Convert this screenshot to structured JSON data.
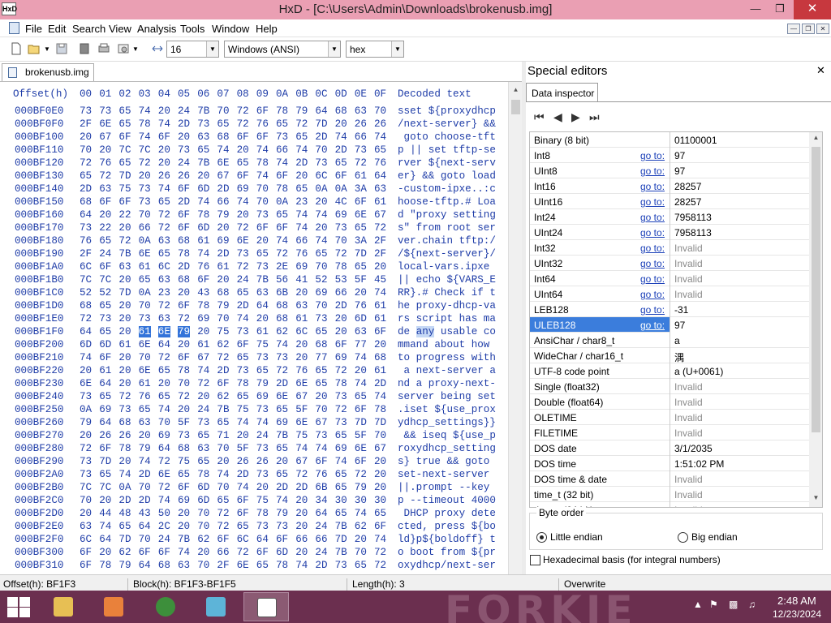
{
  "window": {
    "title": "HxD - [C:\\Users\\Admin\\Downloads\\brokenusb.img]",
    "app_icon": "HxD"
  },
  "menu": [
    "File",
    "Edit",
    "Search",
    "View",
    "Analysis",
    "Tools",
    "Window",
    "Help"
  ],
  "toolbar": {
    "bytes_per_row": "16",
    "charset": "Windows (ANSI)",
    "offset_base": "hex"
  },
  "tab": {
    "label": "brokenusb.img"
  },
  "hex": {
    "header": {
      "offset": "Offset(h)",
      "columns": [
        "00",
        "01",
        "02",
        "03",
        "04",
        "05",
        "06",
        "07",
        "08",
        "09",
        "0A",
        "0B",
        "0C",
        "0D",
        "0E",
        "0F"
      ],
      "decoded": "Decoded text"
    },
    "rows": [
      {
        "offset": "000BF0E0",
        "bytes": "73 73 65 74 20 24 7B 70 72 6F 78 79 64 68 63 70",
        "text": "sset ${proxydhcp"
      },
      {
        "offset": "000BF0F0",
        "bytes": "2F 6E 65 78 74 2D 73 65 72 76 65 72 7D 20 26 26",
        "text": "/next-server} &&"
      },
      {
        "offset": "000BF100",
        "bytes": "20 67 6F 74 6F 20 63 68 6F 6F 73 65 2D 74 66 74",
        "text": " goto choose-tft"
      },
      {
        "offset": "000BF110",
        "bytes": "70 20 7C 7C 20 73 65 74 20 74 66 74 70 2D 73 65",
        "text": "p || set tftp-se"
      },
      {
        "offset": "000BF120",
        "bytes": "72 76 65 72 20 24 7B 6E 65 78 74 2D 73 65 72 76",
        "text": "rver ${next-serv"
      },
      {
        "offset": "000BF130",
        "bytes": "65 72 7D 20 26 26 20 67 6F 74 6F 20 6C 6F 61 64",
        "text": "er} && goto load"
      },
      {
        "offset": "000BF140",
        "bytes": "2D 63 75 73 74 6F 6D 2D 69 70 78 65 0A 0A 3A 63",
        "text": "-custom-ipxe..:c"
      },
      {
        "offset": "000BF150",
        "bytes": "68 6F 6F 73 65 2D 74 66 74 70 0A 23 20 4C 6F 61",
        "text": "hoose-tftp.# Loa"
      },
      {
        "offset": "000BF160",
        "bytes": "64 20 22 70 72 6F 78 79 20 73 65 74 74 69 6E 67",
        "text": "d \"proxy setting"
      },
      {
        "offset": "000BF170",
        "bytes": "73 22 20 66 72 6F 6D 20 72 6F 6F 74 20 73 65 72",
        "text": "s\" from root ser"
      },
      {
        "offset": "000BF180",
        "bytes": "76 65 72 0A 63 68 61 69 6E 20 74 66 74 70 3A 2F",
        "text": "ver.chain tftp:/"
      },
      {
        "offset": "000BF190",
        "bytes": "2F 24 7B 6E 65 78 74 2D 73 65 72 76 65 72 7D 2F",
        "text": "/${next-server}/"
      },
      {
        "offset": "000BF1A0",
        "bytes": "6C 6F 63 61 6C 2D 76 61 72 73 2E 69 70 78 65 20",
        "text": "local-vars.ipxe "
      },
      {
        "offset": "000BF1B0",
        "bytes": "7C 7C 20 65 63 68 6F 20 24 7B 56 41 52 53 5F 45",
        "text": "|| echo ${VARS_E"
      },
      {
        "offset": "000BF1C0",
        "bytes": "52 52 7D 0A 23 20 43 68 65 63 6B 20 69 66 20 74",
        "text": "RR}.# Check if t"
      },
      {
        "offset": "000BF1D0",
        "bytes": "68 65 20 70 72 6F 78 79 2D 64 68 63 70 2D 76 61",
        "text": "he proxy-dhcp-va"
      },
      {
        "offset": "000BF1E0",
        "bytes": "72 73 20 73 63 72 69 70 74 20 68 61 73 20 6D 61",
        "text": "rs script has ma"
      },
      {
        "offset": "000BF1F0",
        "bytes": "64 65 20 61 6E 79 20 75 73 61 62 6C 65 20 63 6F",
        "text": "de any usable co",
        "sel_start": 3,
        "sel_len": 3
      },
      {
        "offset": "000BF200",
        "bytes": "6D 6D 61 6E 64 20 61 62 6F 75 74 20 68 6F 77 20",
        "text": "mmand about how "
      },
      {
        "offset": "000BF210",
        "bytes": "74 6F 20 70 72 6F 67 72 65 73 73 20 77 69 74 68",
        "text": "to progress with"
      },
      {
        "offset": "000BF220",
        "bytes": "20 61 20 6E 65 78 74 2D 73 65 72 76 65 72 20 61",
        "text": " a next-server a"
      },
      {
        "offset": "000BF230",
        "bytes": "6E 64 20 61 20 70 72 6F 78 79 2D 6E 65 78 74 2D",
        "text": "nd a proxy-next-"
      },
      {
        "offset": "000BF240",
        "bytes": "73 65 72 76 65 72 20 62 65 69 6E 67 20 73 65 74",
        "text": "server being set"
      },
      {
        "offset": "000BF250",
        "bytes": "0A 69 73 65 74 20 24 7B 75 73 65 5F 70 72 6F 78",
        "text": ".iset ${use_prox"
      },
      {
        "offset": "000BF260",
        "bytes": "79 64 68 63 70 5F 73 65 74 74 69 6E 67 73 7D 7D",
        "text": "ydhcp_settings}}"
      },
      {
        "offset": "000BF270",
        "bytes": "20 26 26 20 69 73 65 71 20 24 7B 75 73 65 5F 70",
        "text": " && iseq ${use_p"
      },
      {
        "offset": "000BF280",
        "bytes": "72 6F 78 79 64 68 63 70 5F 73 65 74 74 69 6E 67",
        "text": "roxydhcp_setting"
      },
      {
        "offset": "000BF290",
        "bytes": "73 7D 20 74 72 75 65 20 26 26 20 67 6F 74 6F 20",
        "text": "s} true && goto "
      },
      {
        "offset": "000BF2A0",
        "bytes": "73 65 74 2D 6E 65 78 74 2D 73 65 72 76 65 72 20",
        "text": "set-next-server "
      },
      {
        "offset": "000BF2B0",
        "bytes": "7C 7C 0A 70 72 6F 6D 70 74 20 2D 2D 6B 65 79 20",
        "text": "||.prompt --key "
      },
      {
        "offset": "000BF2C0",
        "bytes": "70 20 2D 2D 74 69 6D 65 6F 75 74 20 34 30 30 30",
        "text": "p --timeout 4000"
      },
      {
        "offset": "000BF2D0",
        "bytes": "20 44 48 43 50 20 70 72 6F 78 79 20 64 65 74 65",
        "text": " DHCP proxy dete"
      },
      {
        "offset": "000BF2E0",
        "bytes": "63 74 65 64 2C 20 70 72 65 73 73 20 24 7B 62 6F",
        "text": "cted, press ${bo"
      },
      {
        "offset": "000BF2F0",
        "bytes": "6C 64 7D 70 24 7B 62 6F 6C 64 6F 66 66 7D 20 74",
        "text": "ld}p${boldoff} t"
      },
      {
        "offset": "000BF300",
        "bytes": "6F 20 62 6F 6F 74 20 66 72 6F 6D 20 24 7B 70 72",
        "text": "o boot from ${pr"
      },
      {
        "offset": "000BF310",
        "bytes": "6F 78 79 64 68 63 70 2F 6E 65 78 74 2D 73 65 72",
        "text": "oxydhcp/next-ser"
      }
    ]
  },
  "special_editors": {
    "title": "Special editors",
    "tab": "Data inspector",
    "goto_label": "go to:",
    "rows": [
      {
        "label": "Binary (8 bit)",
        "value": "01100001"
      },
      {
        "label": "Int8",
        "value": "97",
        "goto": true
      },
      {
        "label": "UInt8",
        "value": "97",
        "goto": true
      },
      {
        "label": "Int16",
        "value": "28257",
        "goto": true
      },
      {
        "label": "UInt16",
        "value": "28257",
        "goto": true
      },
      {
        "label": "Int24",
        "value": "7958113",
        "goto": true
      },
      {
        "label": "UInt24",
        "value": "7958113",
        "goto": true
      },
      {
        "label": "Int32",
        "value": "Invalid",
        "goto": true,
        "invalid": true
      },
      {
        "label": "UInt32",
        "value": "Invalid",
        "goto": true,
        "invalid": true
      },
      {
        "label": "Int64",
        "value": "Invalid",
        "goto": true,
        "invalid": true
      },
      {
        "label": "UInt64",
        "value": "Invalid",
        "goto": true,
        "invalid": true
      },
      {
        "label": "LEB128",
        "value": "-31",
        "goto": true
      },
      {
        "label": "ULEB128",
        "value": "97",
        "goto": true,
        "selected": true
      },
      {
        "label": "AnsiChar / char8_t",
        "value": "a"
      },
      {
        "label": "WideChar / char16_t",
        "value": "湡"
      },
      {
        "label": "UTF-8 code point",
        "value": "a (U+0061)"
      },
      {
        "label": "Single (float32)",
        "value": "Invalid",
        "invalid": true
      },
      {
        "label": "Double (float64)",
        "value": "Invalid",
        "invalid": true
      },
      {
        "label": "OLETIME",
        "value": "Invalid",
        "invalid": true
      },
      {
        "label": "FILETIME",
        "value": "Invalid",
        "invalid": true
      },
      {
        "label": "DOS date",
        "value": "3/1/2035"
      },
      {
        "label": "DOS time",
        "value": "1:51:02 PM"
      },
      {
        "label": "DOS time & date",
        "value": "Invalid",
        "invalid": true
      },
      {
        "label": "time_t (32 bit)",
        "value": "Invalid",
        "invalid": true
      },
      {
        "label": "time_t (64 bit)",
        "value": "Invalid",
        "invalid": true
      }
    ],
    "byte_order": {
      "legend": "Byte order",
      "little": "Little endian",
      "big": "Big endian",
      "selected": "little"
    },
    "hex_basis": "Hexadecimal basis (for integral numbers)"
  },
  "status": {
    "offset": "Offset(h): BF1F3",
    "block": "Block(h): BF1F3-BF1F5",
    "length": "Length(h): 3",
    "mode": "Overwrite"
  },
  "taskbar": {
    "time": "2:48 AM",
    "date": "12/23/2024",
    "watermark": "FORKIE"
  },
  "colors": {
    "title_bar": "#ea9fb3",
    "hex_text": "#1f3da8",
    "selection": "#3373d9",
    "taskbar": "#6b2f4f",
    "close": "#c7383e"
  }
}
